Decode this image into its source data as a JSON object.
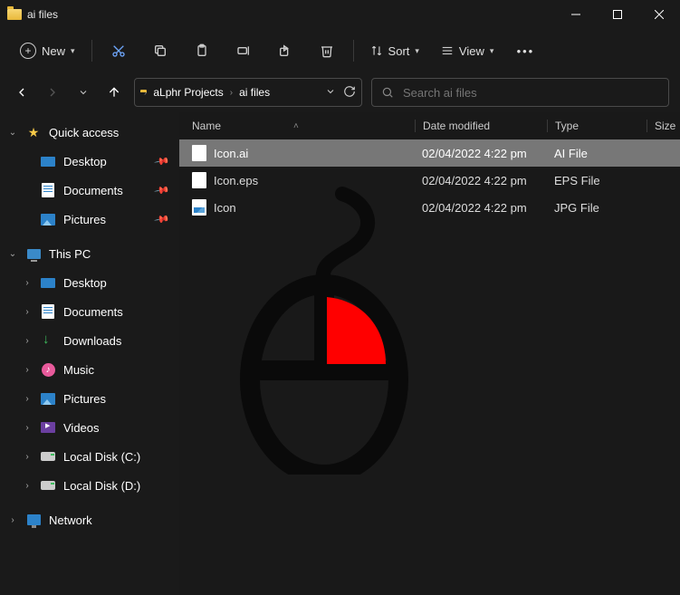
{
  "window": {
    "title": "ai files"
  },
  "toolbar": {
    "new_label": "New",
    "sort_label": "Sort",
    "view_label": "View"
  },
  "breadcrumb": {
    "items": [
      "aLphr Projects",
      "ai files"
    ]
  },
  "search": {
    "placeholder": "Search ai files"
  },
  "sidebar": {
    "quick_access": "Quick access",
    "quick_items": [
      {
        "label": "Desktop",
        "pinned": true
      },
      {
        "label": "Documents",
        "pinned": true
      },
      {
        "label": "Pictures",
        "pinned": true
      }
    ],
    "this_pc": "This PC",
    "pc_items": [
      {
        "label": "Desktop"
      },
      {
        "label": "Documents"
      },
      {
        "label": "Downloads"
      },
      {
        "label": "Music"
      },
      {
        "label": "Pictures"
      },
      {
        "label": "Videos"
      },
      {
        "label": "Local Disk (C:)"
      },
      {
        "label": "Local Disk (D:)"
      }
    ],
    "network": "Network"
  },
  "columns": {
    "name": "Name",
    "date": "Date modified",
    "type": "Type",
    "size": "Size"
  },
  "files": [
    {
      "name": "Icon.ai",
      "date": "02/04/2022 4:22 pm",
      "type": "AI File",
      "selected": true
    },
    {
      "name": "Icon.eps",
      "date": "02/04/2022 4:22 pm",
      "type": "EPS File",
      "selected": false
    },
    {
      "name": "Icon",
      "date": "02/04/2022 4:22 pm",
      "type": "JPG File",
      "selected": false
    }
  ]
}
